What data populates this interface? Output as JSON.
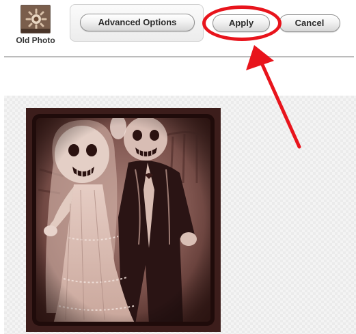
{
  "toolbar": {
    "filter_label": "Old Photo",
    "advanced_label": "Advanced Options",
    "apply_label": "Apply",
    "cancel_label": "Cancel"
  },
  "icons": {
    "filter_thumbnail": "old-photo-thumbnail-icon",
    "annotation": "red-arrow-icon"
  },
  "colors": {
    "annotation": "#e8141c",
    "photo_frame": "#3c1d1b",
    "sepia_tone": "#c9a99e"
  }
}
